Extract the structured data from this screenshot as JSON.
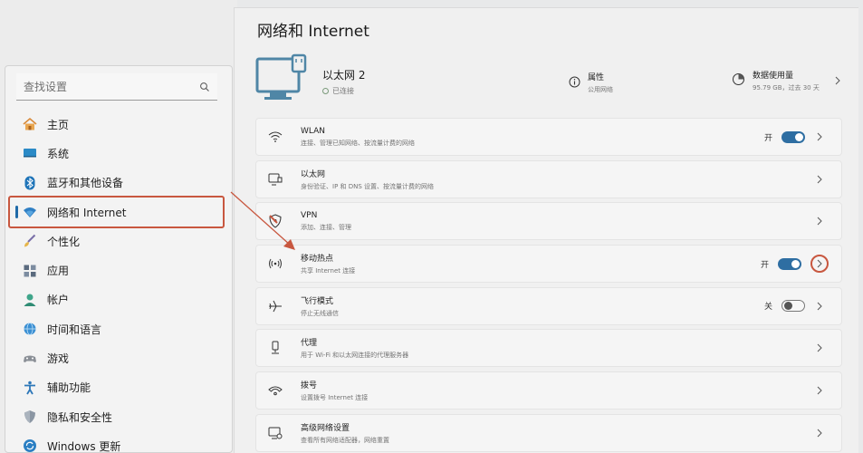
{
  "search": {
    "placeholder": "查找设置"
  },
  "sidebar": {
    "items": [
      {
        "label": "主页",
        "icon": "home-icon"
      },
      {
        "label": "系统",
        "icon": "system-icon"
      },
      {
        "label": "蓝牙和其他设备",
        "icon": "bluetooth-icon"
      },
      {
        "label": "网络和 Internet",
        "icon": "wifi-icon",
        "active": true
      },
      {
        "label": "个性化",
        "icon": "brush-icon"
      },
      {
        "label": "应用",
        "icon": "apps-icon"
      },
      {
        "label": "帐户",
        "icon": "account-icon"
      },
      {
        "label": "时间和语言",
        "icon": "globe-clock-icon"
      },
      {
        "label": "游戏",
        "icon": "gamepad-icon"
      },
      {
        "label": "辅助功能",
        "icon": "accessibility-icon"
      },
      {
        "label": "隐私和安全性",
        "icon": "shield-icon"
      },
      {
        "label": "Windows 更新",
        "icon": "update-icon"
      }
    ]
  },
  "main": {
    "title": "网络和 Internet",
    "hero": {
      "name": "以太网 2",
      "status": "已连接",
      "properties": {
        "title": "属性",
        "sub": "公用网络"
      },
      "usage": {
        "title": "数据使用量",
        "sub": "95.79 GB，过去 30 天"
      }
    },
    "rows": [
      {
        "title": "WLAN",
        "sub": "连接、管理已知网络、按流量计费的网络",
        "state": "开",
        "toggle": "on",
        "icon": "wifi-icon"
      },
      {
        "title": "以太网",
        "sub": "身份验证、IP 和 DNS 设置、按流量计费的网络",
        "icon": "ethernet-icon"
      },
      {
        "title": "VPN",
        "sub": "添加、连接、管理",
        "icon": "vpn-shield-icon"
      },
      {
        "title": "移动热点",
        "sub": "共享 Internet 连接",
        "state": "开",
        "toggle": "on",
        "icon": "hotspot-icon",
        "highlighted": true
      },
      {
        "title": "飞行模式",
        "sub": "停止无线通信",
        "state": "关",
        "toggle": "off",
        "icon": "airplane-icon"
      },
      {
        "title": "代理",
        "sub": "用于 Wi-Fi 和以太网连接的代理服务器",
        "icon": "proxy-icon"
      },
      {
        "title": "拨号",
        "sub": "设置拨号 Internet 连接",
        "icon": "dialup-icon"
      },
      {
        "title": "高级网络设置",
        "sub": "查看所有网络适配器，网络重置",
        "icon": "advanced-network-icon"
      }
    ]
  },
  "colors": {
    "accent": "#2e6ea2",
    "annotation": "#c8573f"
  }
}
